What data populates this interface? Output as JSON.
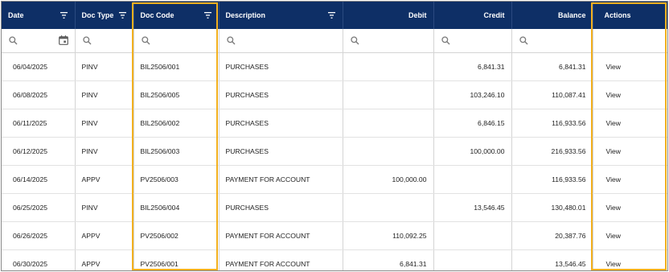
{
  "columns": {
    "date": "Date",
    "doc_type": "Doc Type",
    "doc_code": "Doc Code",
    "description": "Description",
    "debit": "Debit",
    "credit": "Credit",
    "balance": "Balance",
    "actions": "Actions"
  },
  "rows": [
    {
      "date": "06/04/2025",
      "doc_type": "PINV",
      "doc_code": "BIL2506/001",
      "description": "PURCHASES",
      "debit": "",
      "credit": "6,841.31",
      "balance": "6,841.31",
      "action": "View"
    },
    {
      "date": "06/08/2025",
      "doc_type": "PINV",
      "doc_code": "BIL2506/005",
      "description": "PURCHASES",
      "debit": "",
      "credit": "103,246.10",
      "balance": "110,087.41",
      "action": "View"
    },
    {
      "date": "06/11/2025",
      "doc_type": "PINV",
      "doc_code": "BIL2506/002",
      "description": "PURCHASES",
      "debit": "",
      "credit": "6,846.15",
      "balance": "116,933.56",
      "action": "View"
    },
    {
      "date": "06/12/2025",
      "doc_type": "PINV",
      "doc_code": "BIL2506/003",
      "description": "PURCHASES",
      "debit": "",
      "credit": "100,000.00",
      "balance": "216,933.56",
      "action": "View"
    },
    {
      "date": "06/14/2025",
      "doc_type": "APPV",
      "doc_code": "PV2506/003",
      "description": "PAYMENT FOR ACCOUNT",
      "debit": "100,000.00",
      "credit": "",
      "balance": "116,933.56",
      "action": "View"
    },
    {
      "date": "06/25/2025",
      "doc_type": "PINV",
      "doc_code": "BIL2506/004",
      "description": "PURCHASES",
      "debit": "",
      "credit": "13,546.45",
      "balance": "130,480.01",
      "action": "View"
    },
    {
      "date": "06/26/2025",
      "doc_type": "APPV",
      "doc_code": "PV2506/002",
      "description": "PAYMENT FOR ACCOUNT",
      "debit": "110,092.25",
      "credit": "",
      "balance": "20,387.76",
      "action": "View"
    },
    {
      "date": "06/30/2025",
      "doc_type": "APPV",
      "doc_code": "PV2506/001",
      "description": "PAYMENT FOR ACCOUNT",
      "debit": "6,841.31",
      "credit": "",
      "balance": "13,546.45",
      "action": "View"
    }
  ],
  "icons": {
    "filter": "filter-icon",
    "search": "search-icon",
    "calendar": "calendar-icon"
  },
  "colors": {
    "header_bg": "#0e2f66",
    "link": "#2f97d6",
    "action": "#1d4f8a",
    "highlight": "#f2b01e"
  }
}
